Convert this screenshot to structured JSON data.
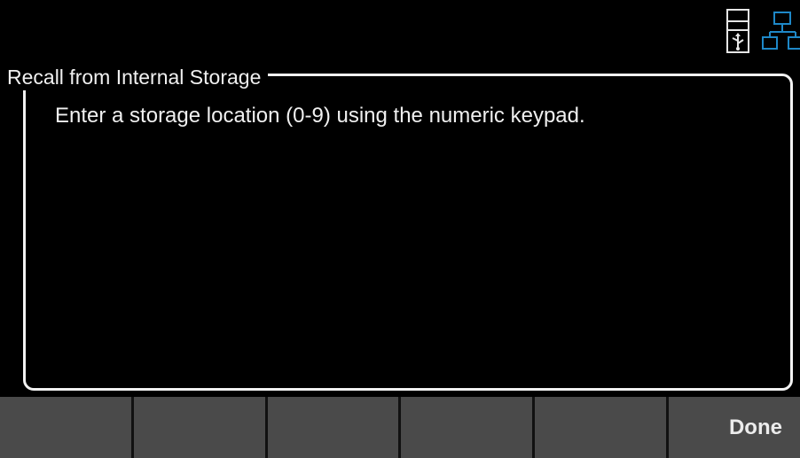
{
  "dialog": {
    "title": "Recall from Internal Storage",
    "message": "Enter a storage location (0-9) using the numeric keypad."
  },
  "status": {
    "usb_icon": "usb-icon",
    "lan_icon": "lan-network-icon",
    "lan_color": "#1e88c8"
  },
  "softkeys": [
    {
      "label": ""
    },
    {
      "label": ""
    },
    {
      "label": ""
    },
    {
      "label": ""
    },
    {
      "label": ""
    },
    {
      "label": "Done"
    }
  ],
  "colors": {
    "background": "#000000",
    "frame": "#f2f2f2",
    "softkey_bg": "#4a4a4a"
  }
}
